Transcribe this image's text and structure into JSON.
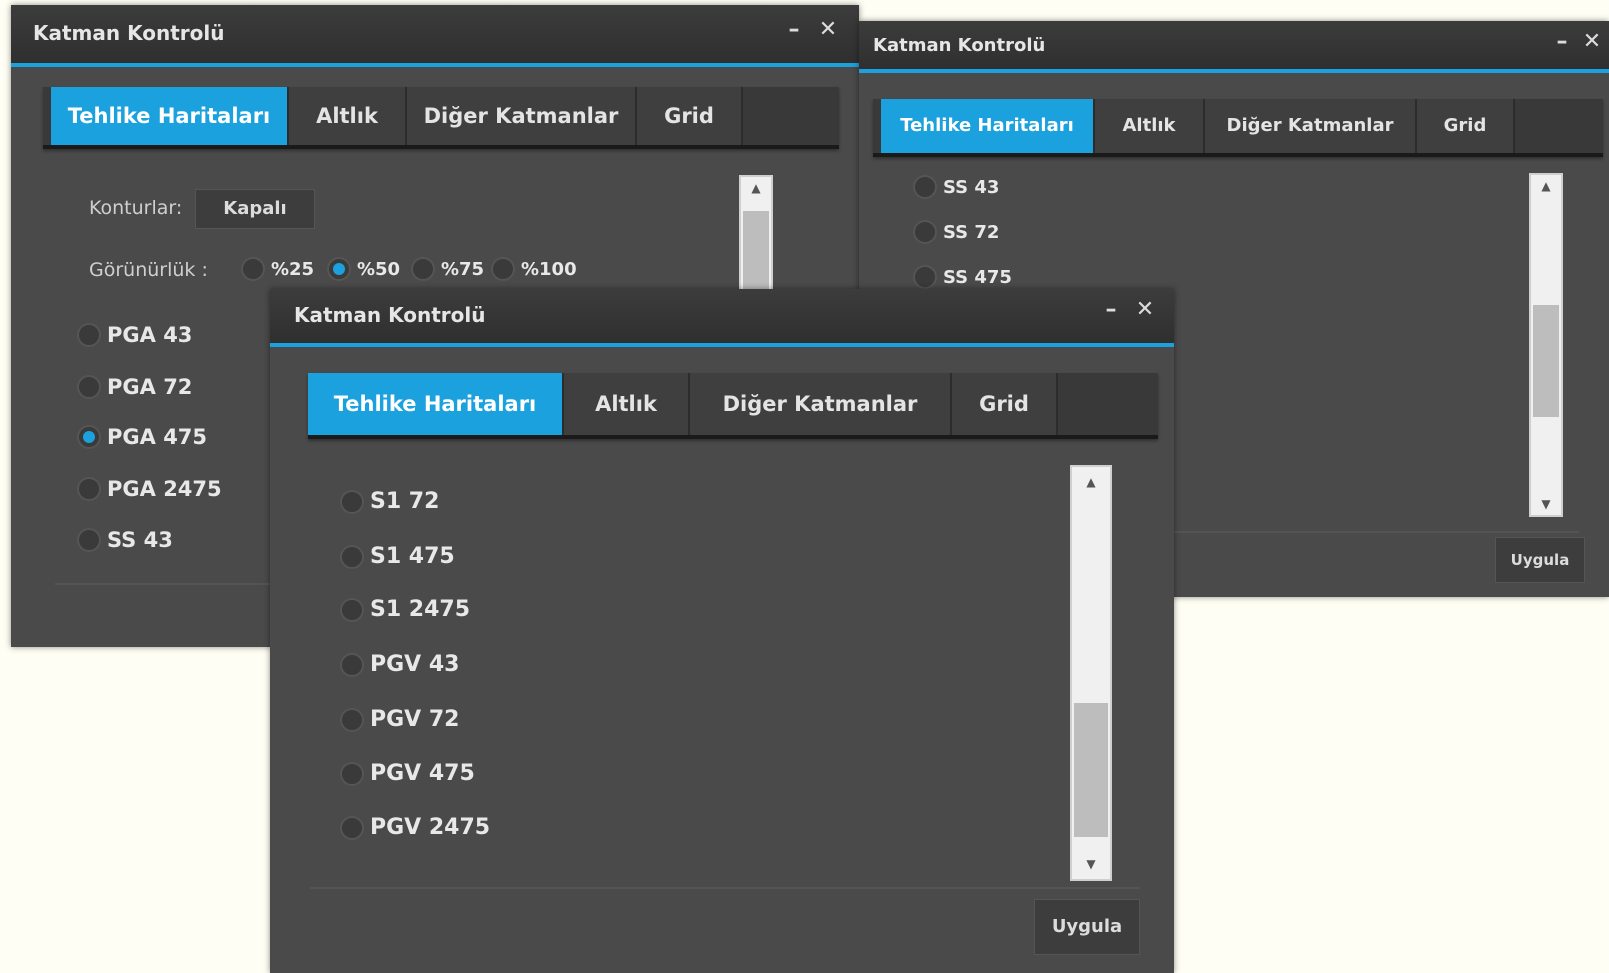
{
  "windows": {
    "left": {
      "title": "Katman Kontrolü",
      "minimize": "–",
      "close": "✕",
      "tabs": [
        "Tehlike Haritaları",
        "Altlık",
        "Diğer Katmanlar",
        "Grid"
      ],
      "contour_label": "Konturlar:",
      "contour_value": "Kapalı",
      "visibility_label": "Görünürlük :",
      "visibility_options": [
        "%25",
        "%50",
        "%75",
        "%100"
      ],
      "visibility_selected": "%50",
      "radio_items": [
        "PGA 43",
        "PGA 72",
        "PGA 475",
        "PGA 2475",
        "SS 43"
      ],
      "selected_item": "PGA 475"
    },
    "right": {
      "title": "Katman Kontrolü",
      "minimize": "–",
      "close": "✕",
      "tabs": [
        "Tehlike Haritaları",
        "Altlık",
        "Diğer Katmanlar",
        "Grid"
      ],
      "radio_items": [
        "SS 43",
        "SS 72",
        "SS 475"
      ],
      "apply": "Uygula"
    },
    "front": {
      "title": "Katman Kontrolü",
      "minimize": "–",
      "close": "✕",
      "tabs": [
        "Tehlike Haritaları",
        "Altlık",
        "Diğer Katmanlar",
        "Grid"
      ],
      "radio_items": [
        "S1 72",
        "S1 475",
        "S1 2475",
        "PGV 43",
        "PGV 72",
        "PGV 475",
        "PGV 2475"
      ],
      "apply": "Uygula"
    }
  },
  "colors": {
    "accent": "#1ba1dd",
    "panel": "#4a4a4a",
    "titlebar": "#333333",
    "background": "#fffef4"
  }
}
